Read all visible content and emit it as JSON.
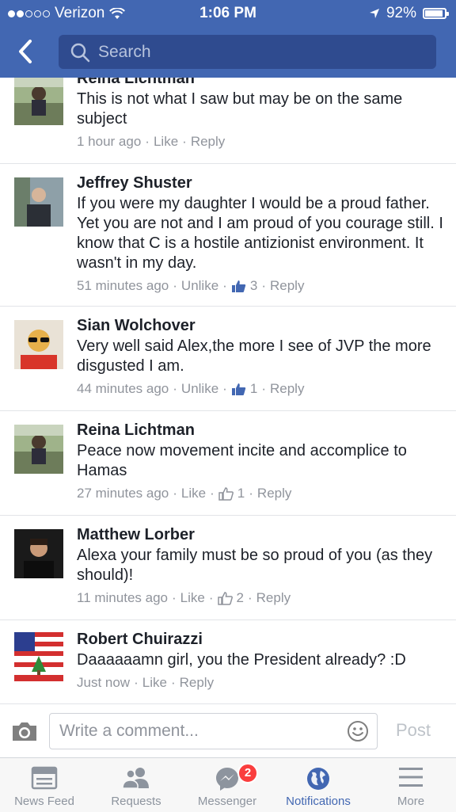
{
  "status_bar": {
    "carrier": "Verizon",
    "time": "1:06 PM",
    "battery": "92%",
    "battery_level": 0.92
  },
  "header": {
    "search_placeholder": "Search"
  },
  "comments": [
    {
      "name": "Reina Lichtman",
      "text": "This is not what I saw but may be on the same subject",
      "time": "1 hour ago",
      "like": "Like",
      "likes": "",
      "reply": "Reply"
    },
    {
      "name": "Jeffrey Shuster",
      "text": "If you were my daughter I would be a proud father. Yet you are not and I am proud of you courage still. I know that C        is a hostile antizionist environment. It wasn't in my day.",
      "time": "51 minutes ago",
      "like": "Unlike",
      "likes": "3",
      "reply": "Reply"
    },
    {
      "name": "Sian Wolchover",
      "text": "Very well said Alex,the more I see of JVP the more disgusted I am.",
      "time": "44 minutes ago",
      "like": "Unlike",
      "likes": "1",
      "reply": "Reply"
    },
    {
      "name": "Reina Lichtman",
      "text": "Peace now movement incite and accomplice to Hamas",
      "time": "27 minutes ago",
      "like": "Like",
      "likes": "1",
      "reply": "Reply"
    },
    {
      "name": "Matthew Lorber",
      "text": "Alexa     your family must be so proud of you (as they should)!",
      "time": "11 minutes ago",
      "like": "Like",
      "likes": "2",
      "reply": "Reply"
    },
    {
      "name": "Robert Chuirazzi",
      "text": "Daaaaaamn girl, you the President already? :D",
      "time": "Just now",
      "like": "Like",
      "likes": "",
      "reply": "Reply"
    }
  ],
  "composer": {
    "placeholder": "Write a comment...",
    "post_label": "Post"
  },
  "tabs": [
    {
      "label": "News Feed"
    },
    {
      "label": "Requests"
    },
    {
      "label": "Messenger",
      "badge": "2"
    },
    {
      "label": "Notifications"
    },
    {
      "label": "More"
    }
  ],
  "colors": {
    "brand": "#4267b2",
    "text": "#1d2129",
    "meta": "#90949c",
    "badge": "#fa3e3e"
  }
}
